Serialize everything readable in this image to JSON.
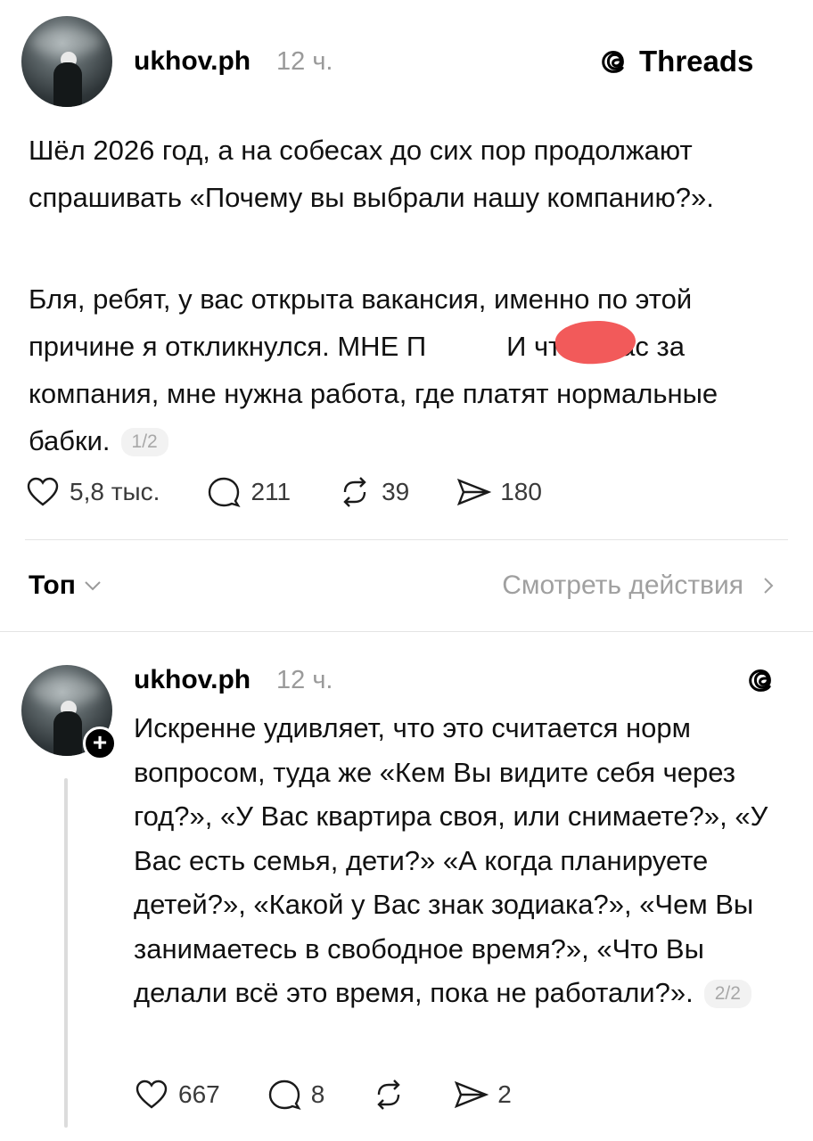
{
  "brand": {
    "name": "Threads",
    "icon": "threads-logo-icon"
  },
  "post": {
    "username": "ukhov.ph",
    "time": "12 ч.",
    "paragraphs": [
      "Шёл 2026 год, а на собесах до сих пор продолжают спрашивать «Почему вы выбрали нашу компанию?».",
      "Бля, ребят, у вас открыта вакансия, именно по этой причине я откликнулся. МНЕ П",
      "И что у вас за компания, мне нужна работа, где платят нормальные бабки."
    ],
    "page_badge": "1/2",
    "likes": "5,8 тыс.",
    "replies": "211",
    "reposts": "39",
    "shares": "180"
  },
  "sort": {
    "label": "Топ",
    "view_actions": "Смотреть действия"
  },
  "reply": {
    "username": "ukhov.ph",
    "time": "12 ч.",
    "text": "Искренне удивляет, что это считается норм вопросом, туда же «Кем Вы видите себя через год?», «У Вас квартира своя, или снимаете?», «У Вас есть семья, дети?» «А когда планируете детей?», «Какой у Вас знак зодиака?», «Чем Вы занимаетесь в свободное время?», «Что Вы делали всё это время, пока не работали?».",
    "page_badge": "2/2",
    "likes": "667",
    "replies": "8",
    "shares": "2",
    "follow_symbol": "+"
  }
}
